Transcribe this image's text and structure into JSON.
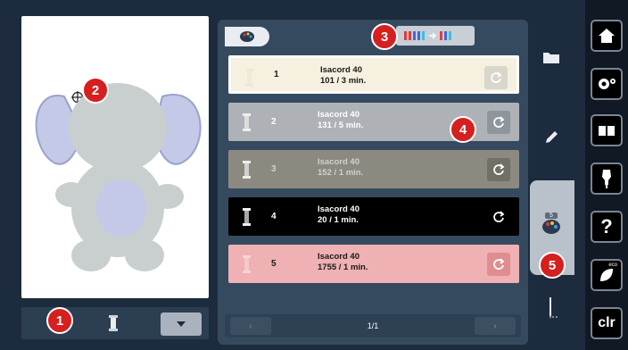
{
  "callouts": [
    "1",
    "2",
    "3",
    "4",
    "5"
  ],
  "pager": {
    "label": "1/1",
    "prev": "‹",
    "next": "›"
  },
  "right_bar": {
    "clr_label": "clr",
    "help_label": "?",
    "eco_label": "eco"
  },
  "tools": {
    "active_count": "5"
  },
  "colors": [
    {
      "number": "1",
      "thread": "Isacord 40",
      "info": "101 / 3 min."
    },
    {
      "number": "2",
      "thread": "Isacord 40",
      "info": "131 / 5 min."
    },
    {
      "number": "3",
      "thread": "Isacord 40",
      "info": "152 / 1 min."
    },
    {
      "number": "4",
      "thread": "Isacord 40",
      "info": "20 / 1 min."
    },
    {
      "number": "5",
      "thread": "Isacord 40",
      "info": "1755 / 1 min."
    }
  ],
  "row_colors": [
    "#f5f0df",
    "#aeb2b6",
    "#8c8a80",
    "#000000",
    "#efb1b3"
  ],
  "accent": "#d61f1f"
}
